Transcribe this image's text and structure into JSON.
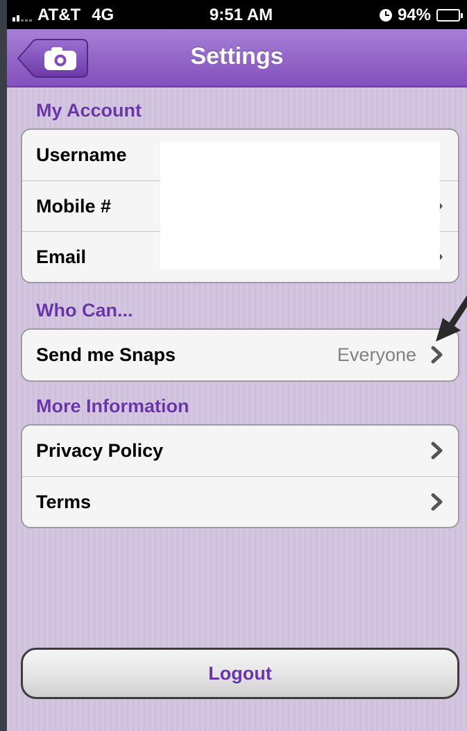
{
  "status_bar": {
    "carrier": "AT&T",
    "network": "4G",
    "time": "9:51 AM",
    "battery": "94%"
  },
  "nav": {
    "title": "Settings",
    "back_icon": "camera-icon"
  },
  "sections": {
    "my_account": {
      "header": "My Account",
      "rows": [
        {
          "label": "Username"
        },
        {
          "label": "Mobile #"
        },
        {
          "label": "Email"
        }
      ]
    },
    "who_can": {
      "header": "Who Can...",
      "rows": [
        {
          "label": "Send me Snaps",
          "value": "Everyone"
        }
      ]
    },
    "more_info": {
      "header": "More Information",
      "rows": [
        {
          "label": "Privacy Policy"
        },
        {
          "label": "Terms"
        }
      ]
    }
  },
  "logout_label": "Logout",
  "colors": {
    "accent": "#6a35a8",
    "nav_bar": "#9467c9",
    "background": "#cfc0de"
  }
}
